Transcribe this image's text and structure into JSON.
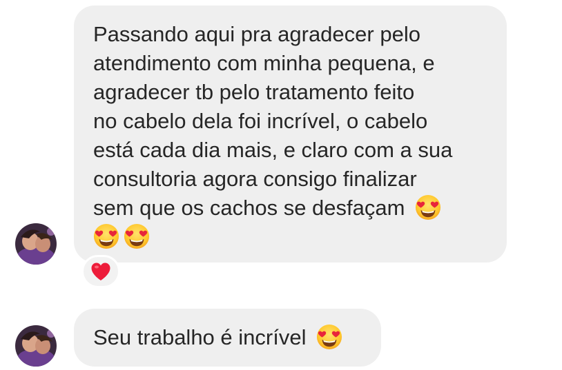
{
  "messages": [
    {
      "lines": [
        "Passando aqui pra agradecer pelo",
        "atendimento com minha pequena, e",
        "agradecer tb pelo tratamento feito",
        "no cabelo dela foi incrível, o cabelo",
        "está cada dia mais, e claro com a sua",
        "consultoria agora consigo finalizar",
        "sem que os cachos se desfaçam"
      ],
      "emoji": "heart-eyes",
      "reaction": "❤️"
    },
    {
      "text": "Seu trabalho é incrível",
      "emoji": "heart-eyes"
    }
  ],
  "colors": {
    "bubble": "#efefef",
    "text": "#262626",
    "heart": "#ed1c3a",
    "emoji_face": "#ffcc33"
  }
}
